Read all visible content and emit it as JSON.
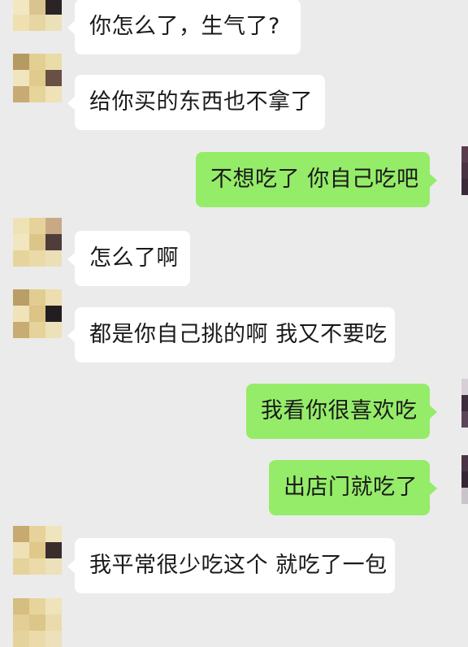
{
  "chat": {
    "messages": [
      {
        "side": "in",
        "text": "你怎么了，生气了?"
      },
      {
        "side": "in",
        "text": "给你买的东西也不拿了"
      },
      {
        "side": "out",
        "text": "不想吃了 你自己吃吧"
      },
      {
        "side": "in",
        "text": "怎么了啊"
      },
      {
        "side": "in",
        "text": "都是你自己挑的啊 我又不要吃"
      },
      {
        "side": "out",
        "text": "我看你很喜欢吃"
      },
      {
        "side": "out",
        "text": "出店门就吃了"
      },
      {
        "side": "in",
        "text": "我平常很少吃这个 就吃了一包"
      }
    ]
  },
  "colors": {
    "background": "#ebebeb",
    "incoming_bubble": "#ffffff",
    "outgoing_bubble": "#95ec69"
  }
}
